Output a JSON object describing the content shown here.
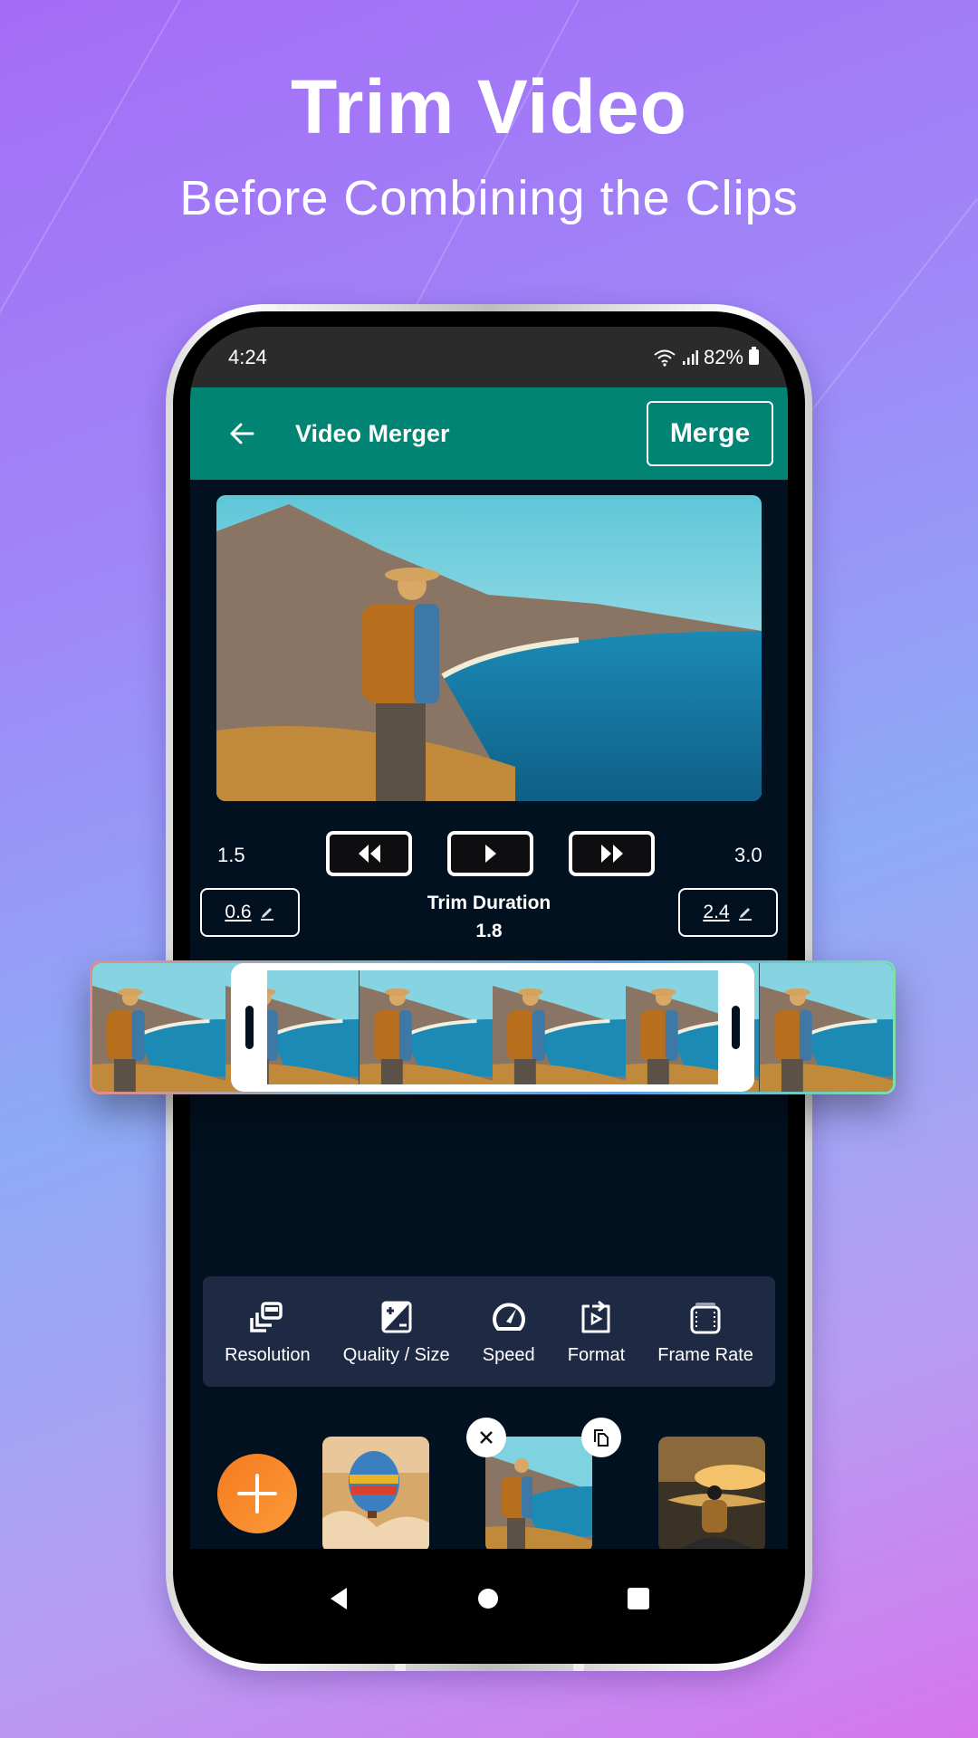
{
  "promo": {
    "headline": "Trim Video",
    "subheadline": "Before Combining the Clips"
  },
  "status_bar": {
    "time": "4:24",
    "battery": "82%",
    "icons": [
      "wifi-icon",
      "signal-icon",
      "battery-icon"
    ]
  },
  "app_bar": {
    "back_icon": "arrow-left-icon",
    "title": "Video Merger",
    "merge_label": "Merge"
  },
  "preview": {
    "description": "hiker with backpack overlooking coastline"
  },
  "playback": {
    "start_time": "1.5",
    "end_time": "3.0",
    "rewind_icon": "rewind-icon",
    "play_icon": "play-icon",
    "forward_icon": "fast-forward-icon"
  },
  "trim": {
    "start_value": "0.6",
    "end_value": "2.4",
    "duration_label": "Trim Duration",
    "duration_value": "1.8",
    "edit_icon": "pencil-icon"
  },
  "timeline": {
    "frame_count": 7,
    "selection_start": 0.2,
    "selection_end": 0.8
  },
  "tools": [
    {
      "label": "Resolution",
      "icon": "resolution-icon"
    },
    {
      "label": "Quality / Size",
      "icon": "exposure-icon"
    },
    {
      "label": "Speed",
      "icon": "speedometer-icon"
    },
    {
      "label": "Format",
      "icon": "format-convert-icon"
    },
    {
      "label": "Frame Rate",
      "icon": "film-frame-icon"
    }
  ],
  "clips": [
    {
      "name": "hot-air-balloon",
      "selected": false
    },
    {
      "name": "hiker-coast",
      "selected": true
    },
    {
      "name": "hiker-sunset-lake",
      "selected": false
    }
  ],
  "clip_actions": {
    "remove_icon": "close-icon",
    "duplicate_icon": "copy-icon"
  },
  "nav": [
    "back",
    "home",
    "recents"
  ],
  "colors": {
    "app_bar": "#028474",
    "screen_bg": "#02111f",
    "toolbar_bg": "#1e2a44",
    "add_button": "#f7831f"
  }
}
